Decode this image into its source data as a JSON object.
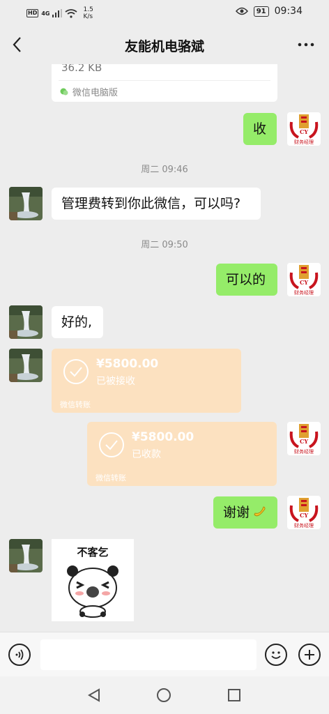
{
  "status_bar": {
    "hd": "HD",
    "network": "4G",
    "speed_value": "1.5",
    "speed_unit": "K/s",
    "battery": "91",
    "time": "09:34"
  },
  "header": {
    "title": "友能机电骆斌",
    "back_icon": "chevron-left-icon",
    "more_icon": "more-dots-icon"
  },
  "messages": {
    "file_size": "36.2 KB",
    "file_source": "微信电脑版",
    "msg_shou": "收",
    "ts1": "周二 09:46",
    "msg_fee": "管理费转到你此微信，可以吗?",
    "ts2": "周二 09:50",
    "msg_ok": "可以的",
    "msg_good": "好的,",
    "transfer1": {
      "amount": "¥5800.00",
      "status": "已被接收",
      "label": "微信转账"
    },
    "transfer2": {
      "amount": "¥5800.00",
      "status": "已收款",
      "label": "微信转账"
    },
    "msg_thanks": "谢谢",
    "sticker_text": "不客乞",
    "logo_caption": "财务经理",
    "logo_letters": "CY"
  },
  "input": {
    "placeholder": ""
  },
  "colors": {
    "green_bubble": "#95ec69",
    "transfer_bg": "#fce1c0",
    "background": "#ededed"
  }
}
